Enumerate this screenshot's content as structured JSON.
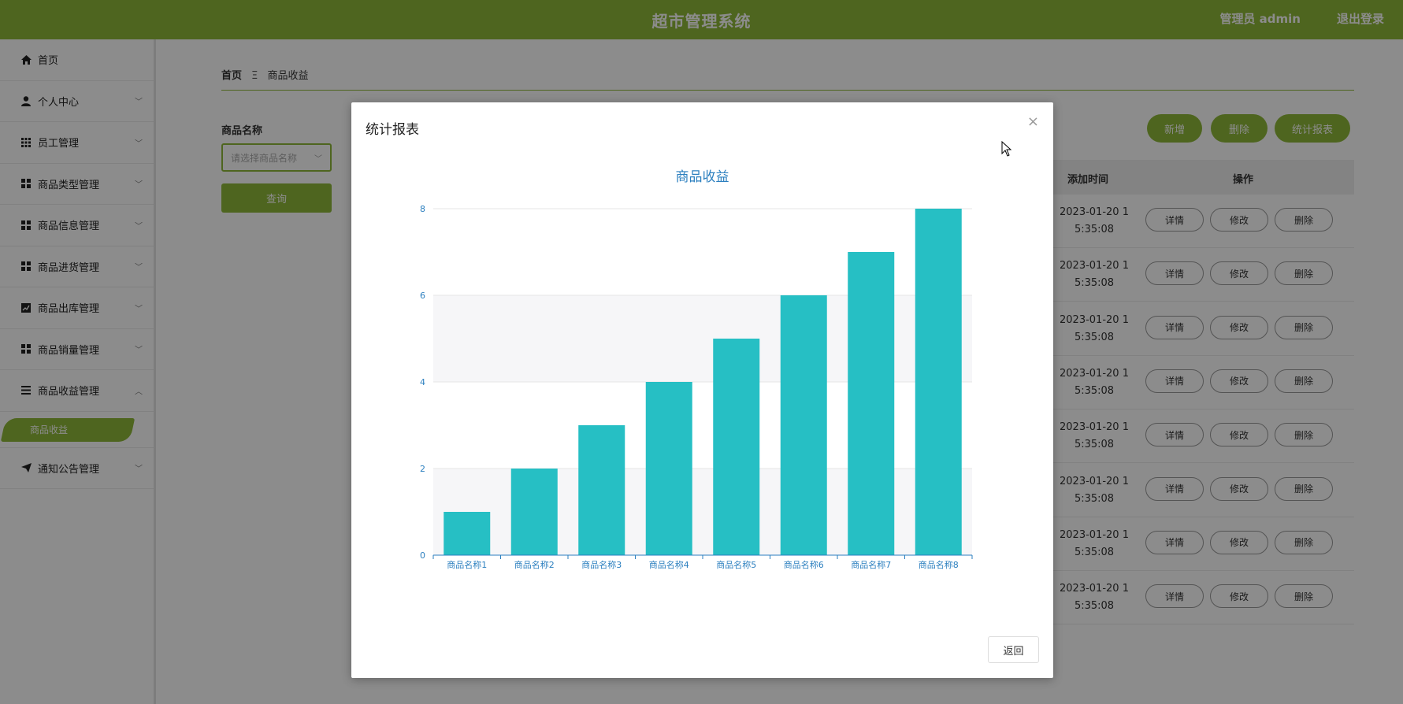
{
  "header": {
    "title": "超市管理系统",
    "user": "管理员 admin",
    "logout": "退出登录"
  },
  "sidebar": {
    "items": [
      {
        "label": "首页",
        "icon": "home-icon",
        "expandable": false
      },
      {
        "label": "个人中心",
        "icon": "user-icon",
        "expandable": true
      },
      {
        "label": "员工管理",
        "icon": "grid-icon",
        "expandable": true
      },
      {
        "label": "商品类型管理",
        "icon": "grid-icon",
        "expandable": true
      },
      {
        "label": "商品信息管理",
        "icon": "grid-icon",
        "expandable": true
      },
      {
        "label": "商品进货管理",
        "icon": "grid-icon",
        "expandable": true
      },
      {
        "label": "商品出库管理",
        "icon": "chart-icon",
        "expandable": true
      },
      {
        "label": "商品销量管理",
        "icon": "grid-icon",
        "expandable": true
      },
      {
        "label": "商品收益管理",
        "icon": "menu-icon",
        "expandable": true,
        "expanded": true
      },
      {
        "label": "通知公告管理",
        "icon": "send-icon",
        "expandable": true
      }
    ],
    "active_sub": "商品收益"
  },
  "breadcrumb": {
    "home": "首页",
    "separator": "Ξ",
    "current": "商品收益"
  },
  "filter": {
    "label": "商品名称",
    "placeholder": "请选择商品名称",
    "query_button": "查询"
  },
  "actions": {
    "add": "新增",
    "delete": "删除",
    "report": "统计报表"
  },
  "table": {
    "headers": {
      "time": "添加时间",
      "ops": "操作"
    },
    "rows": [
      {
        "time_line1": "2023-01-20 1",
        "time_line2": "5:35:08"
      },
      {
        "time_line1": "2023-01-20 1",
        "time_line2": "5:35:08"
      },
      {
        "time_line1": "2023-01-20 1",
        "time_line2": "5:35:08"
      },
      {
        "time_line1": "2023-01-20 1",
        "time_line2": "5:35:08"
      },
      {
        "time_line1": "2023-01-20 1",
        "time_line2": "5:35:08"
      },
      {
        "time_line1": "2023-01-20 1",
        "time_line2": "5:35:08"
      },
      {
        "time_line1": "2023-01-20 1",
        "time_line2": "5:35:08"
      },
      {
        "time_line1": "2023-01-20 1",
        "time_line2": "5:35:08"
      }
    ],
    "row_buttons": {
      "detail": "详情",
      "edit": "修改",
      "delete": "删除"
    }
  },
  "modal": {
    "title": "统计报表",
    "close": "×",
    "back": "返回"
  },
  "colors": {
    "brand": "#8fb93a",
    "bar": "#26bfc4",
    "axis": "#2b7fbf"
  },
  "chart_data": {
    "type": "bar",
    "title": "商品收益",
    "categories": [
      "商品名称1",
      "商品名称2",
      "商品名称3",
      "商品名称4",
      "商品名称5",
      "商品名称6",
      "商品名称7",
      "商品名称8"
    ],
    "values": [
      1,
      2,
      3,
      4,
      5,
      6,
      7,
      8
    ],
    "ylim": [
      0,
      8
    ],
    "yticks": [
      0,
      2,
      4,
      6,
      8
    ],
    "xlabel": "",
    "ylabel": "",
    "grid": true,
    "legend": "none"
  }
}
